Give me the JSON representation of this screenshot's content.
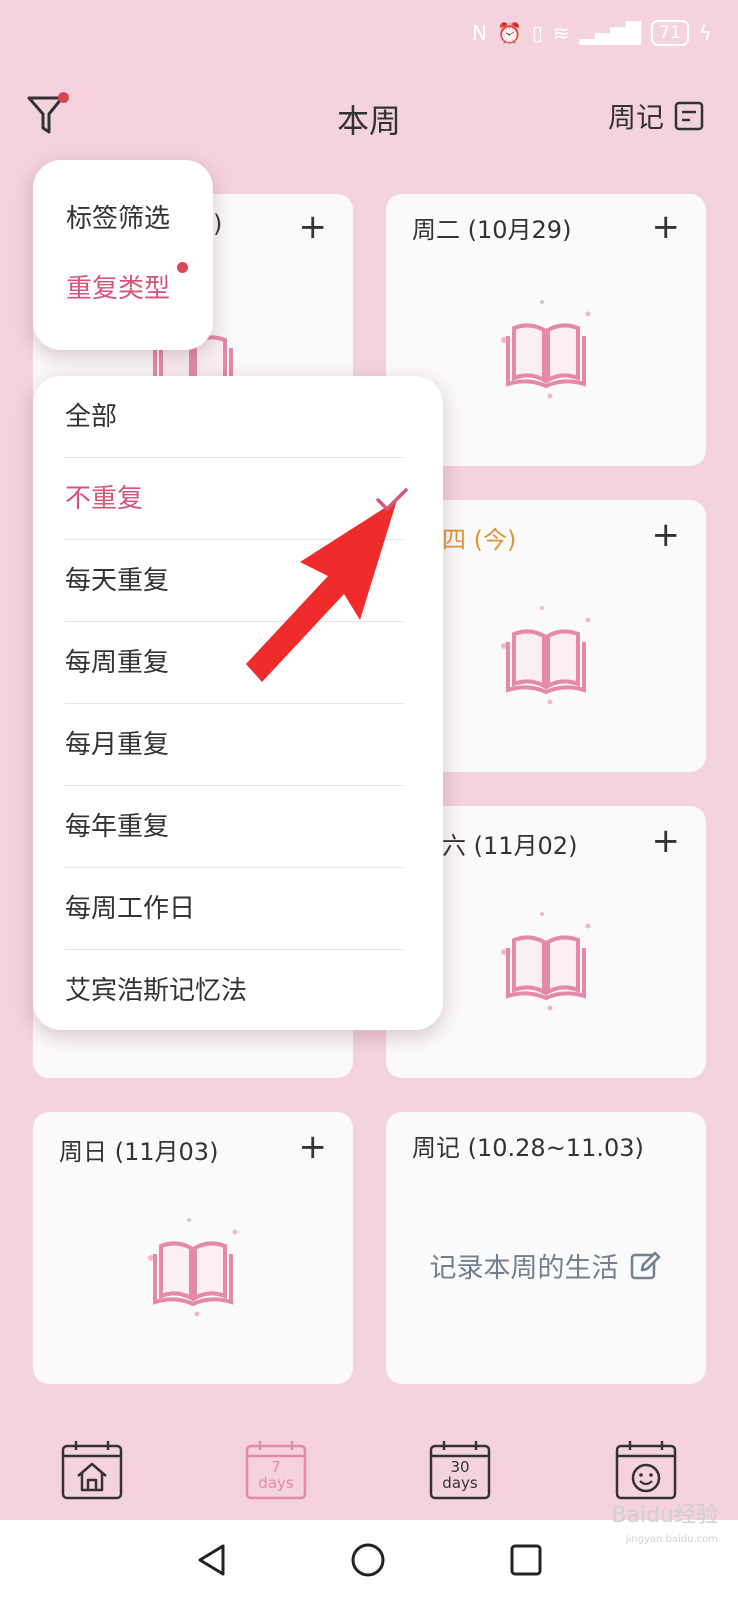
{
  "status_bar": {
    "battery": "71"
  },
  "header": {
    "title": "本周",
    "journal_label": "周记"
  },
  "filter_popup": {
    "items": [
      {
        "label": "标签筛选"
      },
      {
        "label": "重复类型"
      }
    ]
  },
  "repeat_menu": {
    "items": [
      {
        "label": "全部"
      },
      {
        "label": "不重复"
      },
      {
        "label": "每天重复"
      },
      {
        "label": "每周重复"
      },
      {
        "label": "每月重复"
      },
      {
        "label": "每年重复"
      },
      {
        "label": "每周工作日"
      },
      {
        "label": "艾宾浩斯记忆法"
      }
    ],
    "selected_index": 1
  },
  "cards": {
    "monday": {
      "title": ")"
    },
    "tuesday": {
      "title": "周二 (10月29)"
    },
    "thursday": {
      "title": "四 (今)"
    },
    "saturday": {
      "title": "六 (11月02)"
    },
    "sunday": {
      "title": "周日 (11月03)"
    },
    "weekly_journal": {
      "title": "周记 (10.28~11.03)",
      "prompt": "记录本周的生活"
    }
  },
  "plus_symbol": "+",
  "tabs": {
    "week_top": "7",
    "week_bottom": "days",
    "month_top": "30",
    "month_bottom": "days"
  },
  "watermark": {
    "main": "Baidu经验",
    "sub": "jingyan.baidu.com"
  },
  "colors": {
    "background": "#f5d3de",
    "card": "#fbfafb",
    "accent_pink": "#d6567a",
    "today_orange": "#e0943c",
    "arrow_red": "#ef2b2b"
  }
}
